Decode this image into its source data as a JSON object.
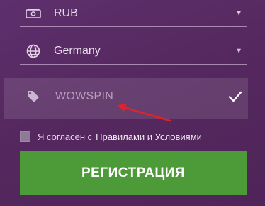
{
  "form": {
    "currency": {
      "value": "RUB",
      "icon": "money-icon"
    },
    "country": {
      "value": "Germany",
      "icon": "globe-icon"
    },
    "promo": {
      "value": "WOWSPIN",
      "icon": "tag-icon",
      "valid_icon": "checkmark-icon"
    },
    "agreement": {
      "text": "Я согласен с",
      "link_text": "Правилами и Условиями",
      "checked": false
    },
    "register_label": "РЕГИСТРАЦИЯ"
  },
  "annotation": {
    "arrow_color": "#e0232a"
  },
  "colors": {
    "background": "#55295f",
    "button": "#4d9a38",
    "text": "#e8dbeb"
  }
}
